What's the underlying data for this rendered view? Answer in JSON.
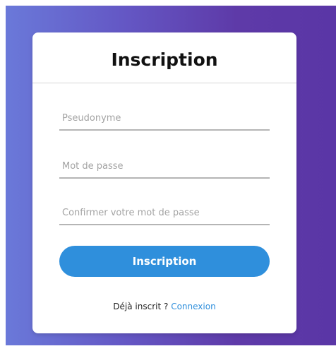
{
  "title": "Inscription",
  "fields": {
    "username": {
      "placeholder": "Pseudonyme",
      "value": ""
    },
    "password": {
      "placeholder": "Mot de passe",
      "value": ""
    },
    "confirm_password": {
      "placeholder": "Confirmer votre mot de passe",
      "value": ""
    }
  },
  "submit_label": "Inscription",
  "footer": {
    "text": "Déjà inscrit ?",
    "link_label": "Connexion"
  },
  "colors": {
    "accent": "#2f8fdc",
    "gradient_start": "#6a79d9",
    "gradient_end": "#5a36a6"
  }
}
